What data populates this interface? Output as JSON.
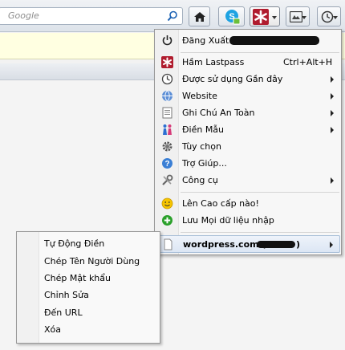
{
  "search": {
    "placeholder": "Google"
  },
  "toolbar": {
    "buttons": [
      "home-button",
      "skype-button",
      "lastpass-button",
      "screen-button",
      "history-button"
    ]
  },
  "menu": {
    "items": [
      {
        "label": "Đăng Xuất: ",
        "icon": "power-icon",
        "submenu": false,
        "redacted": true
      },
      {
        "label": "Hầm Lastpass",
        "icon": "lastpass-icon",
        "shortcut": "Ctrl+Alt+H",
        "submenu": false
      },
      {
        "label": "Được sử dụng Gần đây",
        "icon": "clock-icon",
        "submenu": true
      },
      {
        "label": "Website",
        "icon": "globe-icon",
        "submenu": true
      },
      {
        "label": "Ghi Chú An Toàn",
        "icon": "note-icon",
        "submenu": true
      },
      {
        "label": "Điền Mẫu",
        "icon": "people-icon",
        "submenu": true
      },
      {
        "label": "Tùy chọn",
        "icon": "gear-icon",
        "submenu": false
      },
      {
        "label": "Trợ Giúp...",
        "icon": "help-icon",
        "submenu": false
      },
      {
        "label": "Công cụ",
        "icon": "tools-icon",
        "submenu": true
      },
      {
        "label": "Lên Cao cấp nào!",
        "icon": "smiley-icon",
        "submenu": false
      },
      {
        "label": "Lưu Mọi dữ liệu nhập",
        "icon": "add-icon",
        "submenu": false
      },
      {
        "label": "wordpress.com (",
        "icon": "page-icon",
        "submenu": true,
        "redacted_suffix": ")"
      }
    ]
  },
  "submenu": {
    "items": [
      "Tự Động Điền",
      "Chép Tên Người Dùng",
      "Chép Mật khẩu",
      "Chỉnh Sửa",
      "Đến URL",
      "Xóa"
    ]
  },
  "colors": {
    "lastpass_red": "#b01c2e",
    "highlight": "#dce6f4",
    "infobar": "#ffffe1"
  }
}
